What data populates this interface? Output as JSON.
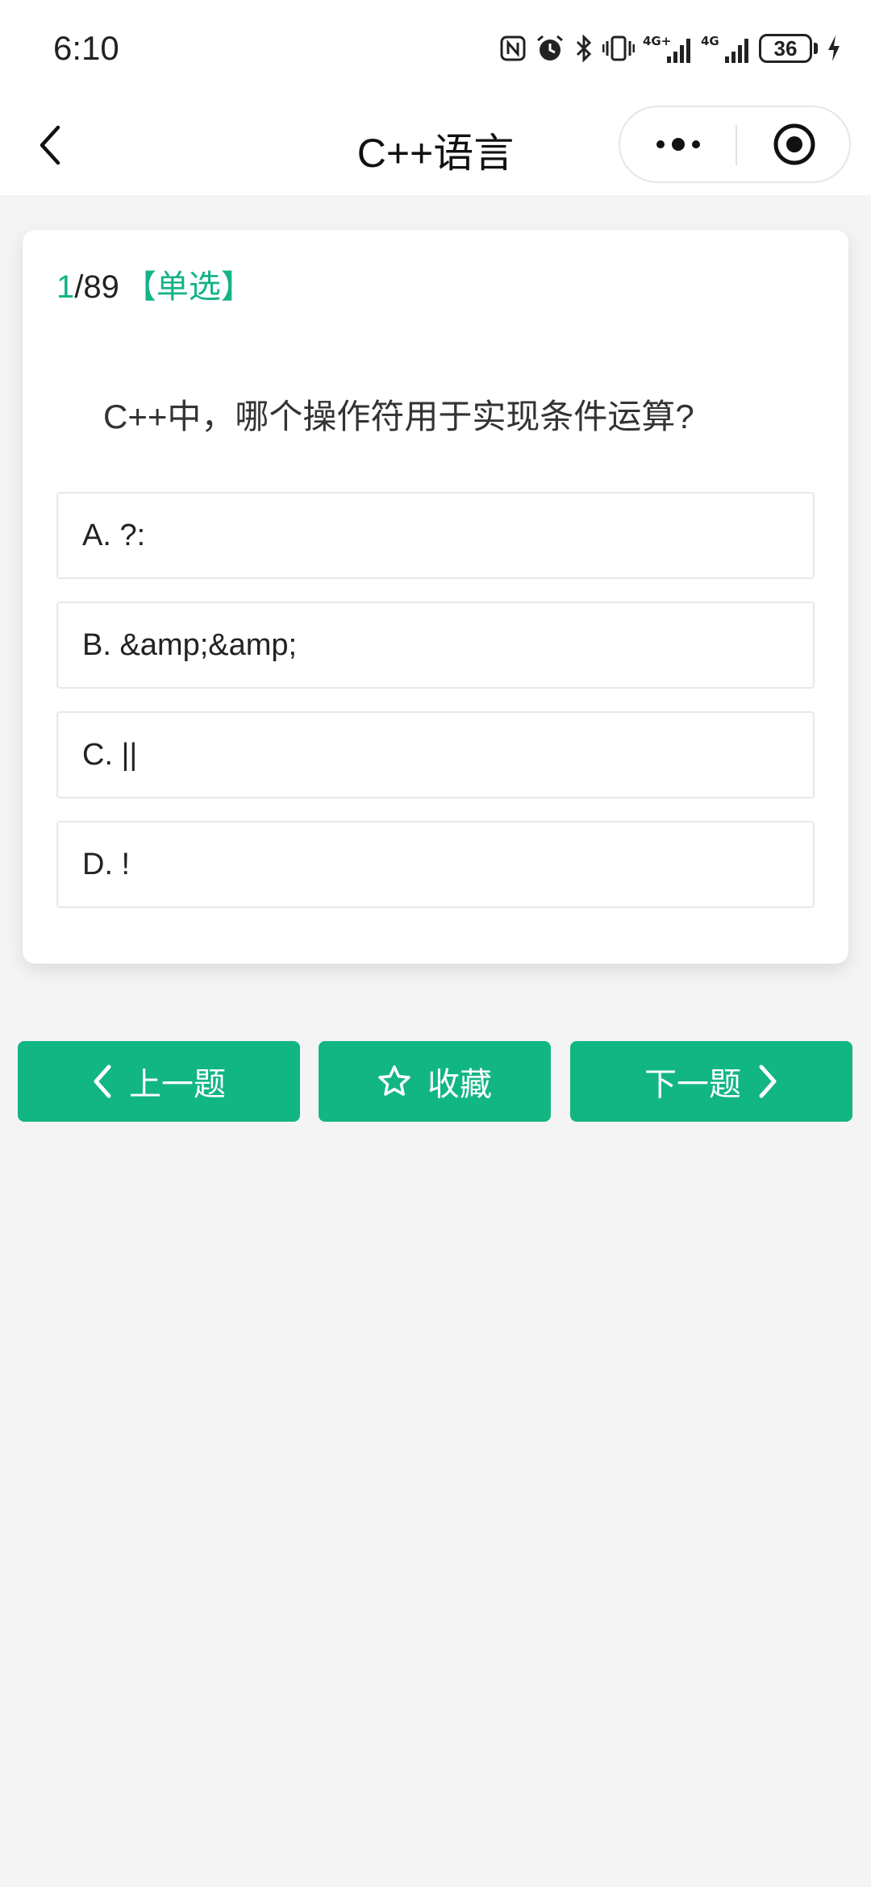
{
  "status_bar": {
    "time": "6:10",
    "battery": "36",
    "icons": [
      "nfc-icon",
      "alarm-icon",
      "bluetooth-icon",
      "vibrate-icon",
      "signal-4g-plus-icon",
      "signal-4g-icon",
      "battery-icon",
      "charging-icon"
    ]
  },
  "navbar": {
    "title": "C++语言",
    "back_icon": "chevron-left-icon",
    "more_icon": "more-dots-icon",
    "close_icon": "target-circle-icon"
  },
  "question": {
    "current": "1",
    "total": "/89",
    "type": "【单选】",
    "text": "C++中，哪个操作符用于实现条件运算?",
    "options": [
      {
        "label": "A. ?:"
      },
      {
        "label": "B. &amp;&amp;"
      },
      {
        "label": "C. ||"
      },
      {
        "label": "D. !"
      }
    ]
  },
  "actions": {
    "prev_label": "上一题",
    "favorite_label": "收藏",
    "next_label": "下一题"
  },
  "colors": {
    "accent": "#11b683",
    "background": "#f4f4f4"
  }
}
